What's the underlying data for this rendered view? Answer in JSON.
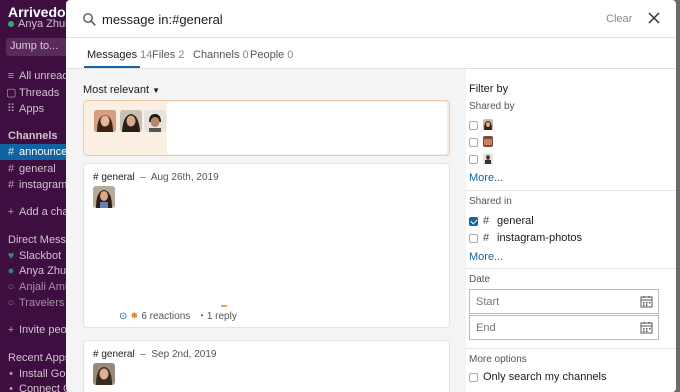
{
  "sidebar": {
    "workspace": "Arrivedo W",
    "user": "Anya Zhuko",
    "jump_to": "Jump to...",
    "items": [
      {
        "label": "All unreads",
        "glyph": "≡"
      },
      {
        "label": "Threads",
        "glyph": "▢"
      },
      {
        "label": "Apps",
        "glyph": "⠿"
      }
    ],
    "channels_header": "Channels",
    "channels": [
      "announcem",
      "general",
      "instagram-p"
    ],
    "add_channel": "Add a chan",
    "dm_header": "Direct Messag",
    "dms": [
      "Slackbot",
      "Anya Zhuko",
      "Anjali Amit",
      "Travelers W"
    ],
    "invite": "Invite peop",
    "recent_apps_header": "Recent Apps",
    "apps": [
      "Install Goog",
      "Connect Google Drive"
    ]
  },
  "search": {
    "query": "message in:#general",
    "clear_label": "Clear"
  },
  "tabs": [
    {
      "label": "Messages",
      "count": "14"
    },
    {
      "label": "Files",
      "count": "2"
    },
    {
      "label": "Channels",
      "count": "0"
    },
    {
      "label": "People",
      "count": "0"
    }
  ],
  "results": {
    "sort_label": "Most relevant",
    "messages": [
      {
        "channel": "# general",
        "date": "Aug 26th, 2019",
        "reactions": "6 reactions",
        "replies": "1 reply"
      },
      {
        "channel": "# general",
        "date": "Sep 2nd, 2019"
      }
    ]
  },
  "filter": {
    "title": "Filter by",
    "shared_by_label": "Shared by",
    "more_1": "More...",
    "shared_in_label": "Shared in",
    "channels": [
      {
        "name": "general",
        "checked": true
      },
      {
        "name": "instagram-photos",
        "checked": false
      }
    ],
    "more_2": "More...",
    "date_label": "Date",
    "start_placeholder": "Start",
    "end_placeholder": "End",
    "more_options_label": "More options",
    "only_my_channels": "Only search my channels"
  },
  "colors": {
    "accent": "#1264a3",
    "sidebar": "#3f0e40",
    "highlight_card": "#fbeee3"
  }
}
